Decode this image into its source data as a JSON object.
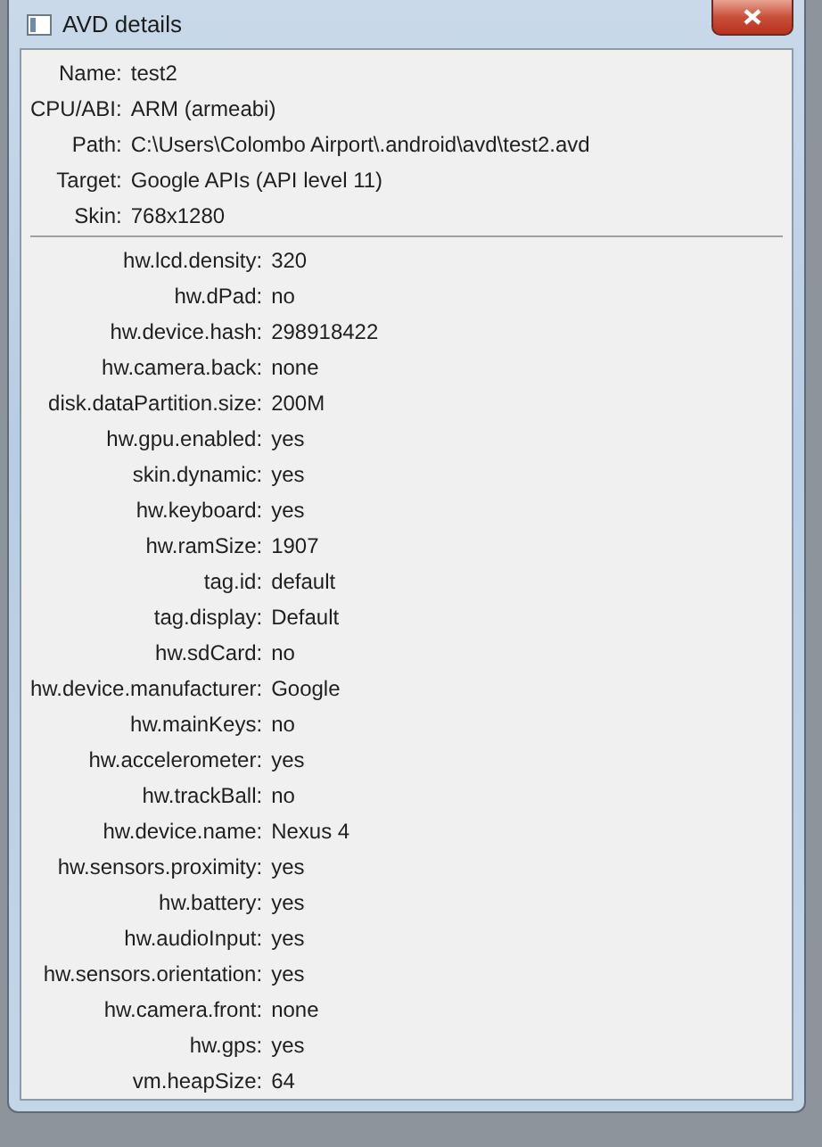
{
  "window": {
    "title": "AVD details"
  },
  "summary": [
    {
      "label": "Name:",
      "value": "test2"
    },
    {
      "label": "CPU/ABI:",
      "value": "ARM (armeabi)"
    },
    {
      "label": "Path:",
      "value": "C:\\Users\\Colombo Airport\\.android\\avd\\test2.avd"
    },
    {
      "label": "Target:",
      "value": "Google APIs (API level 11)"
    },
    {
      "label": "Skin:",
      "value": "768x1280"
    }
  ],
  "properties": [
    {
      "label": "hw.lcd.density:",
      "value": "320"
    },
    {
      "label": "hw.dPad:",
      "value": "no"
    },
    {
      "label": "hw.device.hash:",
      "value": "298918422"
    },
    {
      "label": "hw.camera.back:",
      "value": "none"
    },
    {
      "label": "disk.dataPartition.size:",
      "value": "200M"
    },
    {
      "label": "hw.gpu.enabled:",
      "value": "yes"
    },
    {
      "label": "skin.dynamic:",
      "value": "yes"
    },
    {
      "label": "hw.keyboard:",
      "value": "yes"
    },
    {
      "label": "hw.ramSize:",
      "value": "1907"
    },
    {
      "label": "tag.id:",
      "value": "default"
    },
    {
      "label": "tag.display:",
      "value": "Default"
    },
    {
      "label": "hw.sdCard:",
      "value": "no"
    },
    {
      "label": "hw.device.manufacturer:",
      "value": "Google"
    },
    {
      "label": "hw.mainKeys:",
      "value": "no"
    },
    {
      "label": "hw.accelerometer:",
      "value": "yes"
    },
    {
      "label": "hw.trackBall:",
      "value": "no"
    },
    {
      "label": "hw.device.name:",
      "value": "Nexus 4"
    },
    {
      "label": "hw.sensors.proximity:",
      "value": "yes"
    },
    {
      "label": "hw.battery:",
      "value": "yes"
    },
    {
      "label": "hw.audioInput:",
      "value": "yes"
    },
    {
      "label": "hw.sensors.orientation:",
      "value": "yes"
    },
    {
      "label": "hw.camera.front:",
      "value": "none"
    },
    {
      "label": "hw.gps:",
      "value": "yes"
    },
    {
      "label": "vm.heapSize:",
      "value": "64"
    }
  ]
}
